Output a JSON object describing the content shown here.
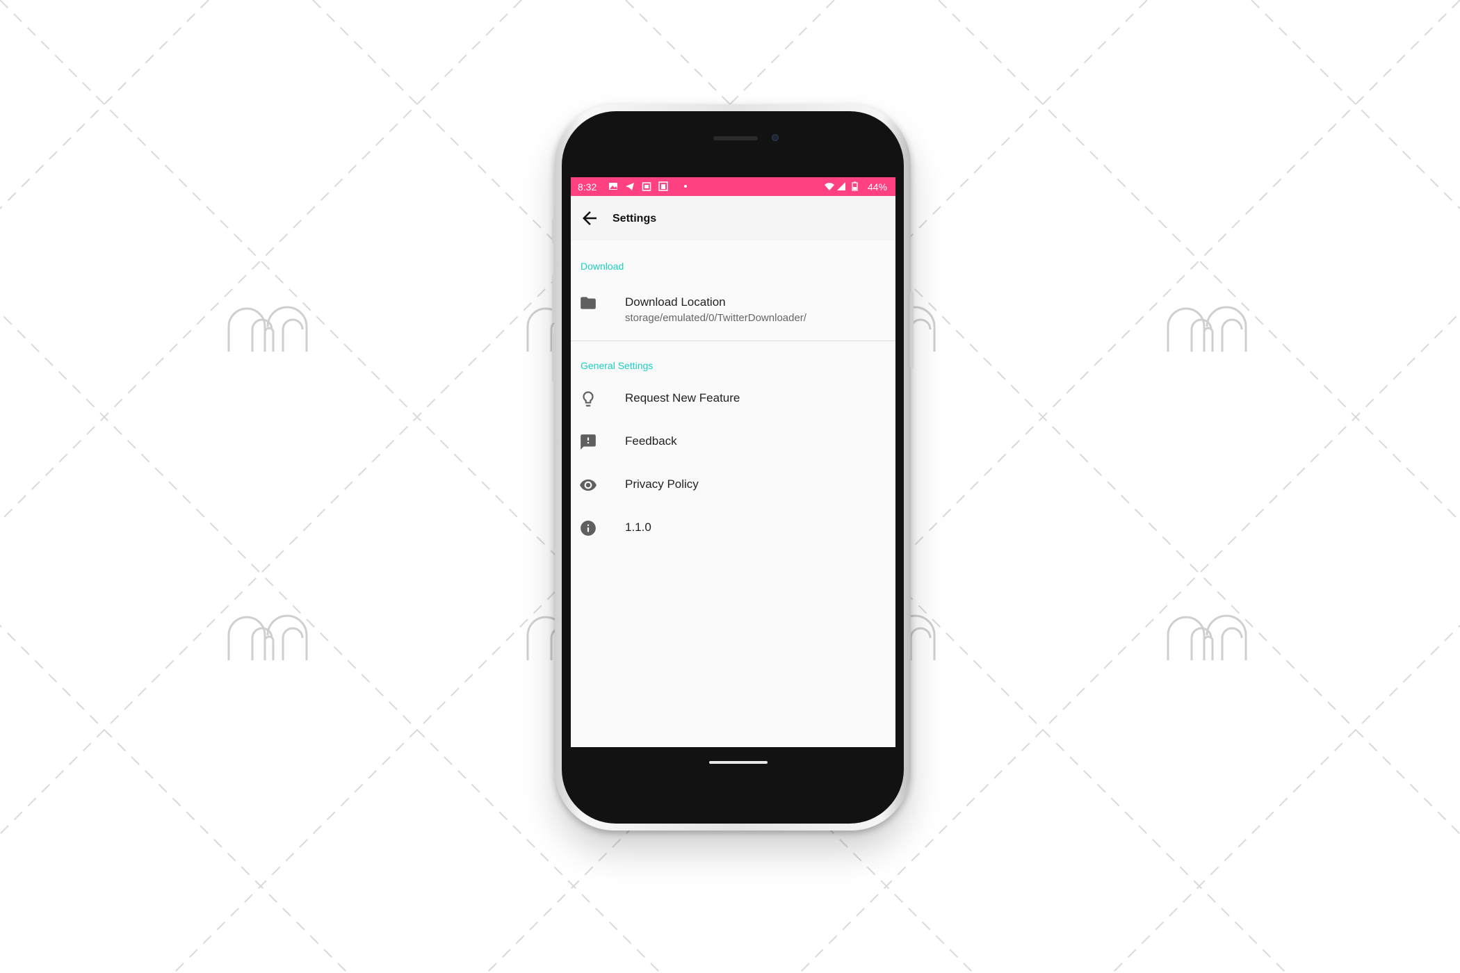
{
  "status_bar": {
    "time": "8:32",
    "battery_percent": "44%",
    "icons": [
      "image-icon",
      "telegram-icon",
      "calendar-icon",
      "gallery-icon",
      "dot-icon",
      "wifi-icon",
      "signal-icon",
      "battery-icon"
    ]
  },
  "app_bar": {
    "title": "Settings",
    "back_icon": "arrow-back-icon"
  },
  "sections": {
    "download": {
      "header": "Download",
      "items": [
        {
          "title": "Download Location",
          "summary": "storage/emulated/0/TwitterDownloader/",
          "icon": "folder-icon"
        }
      ]
    },
    "general": {
      "header": "General Settings",
      "items": [
        {
          "title": "Request New Feature",
          "icon": "lightbulb-icon"
        },
        {
          "title": "Feedback",
          "icon": "feedback-icon"
        },
        {
          "title": "Privacy Policy",
          "icon": "eye-icon"
        },
        {
          "title": "1.1.0",
          "icon": "info-icon"
        }
      ]
    }
  },
  "colors": {
    "status_bar": "#ff4081",
    "accent": "#1ccfc0",
    "screen_bg": "#fafafa",
    "icon": "#5f5f5f"
  },
  "watermark": {
    "icon": "m-logo-watermark"
  }
}
